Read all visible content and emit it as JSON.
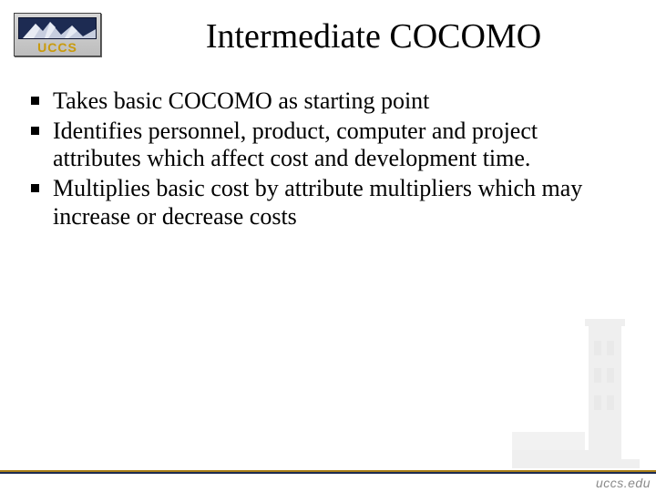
{
  "logo": {
    "text": "UCCS"
  },
  "title": "Intermediate COCOMO",
  "bullets": [
    " Takes basic COCOMO as starting point",
    "    Identifies personnel, product, computer and project attributes which affect cost and development time.",
    "Multiplies basic cost by attribute multipliers which may increase or decrease costs"
  ],
  "footer": {
    "url": "uccs.edu"
  }
}
